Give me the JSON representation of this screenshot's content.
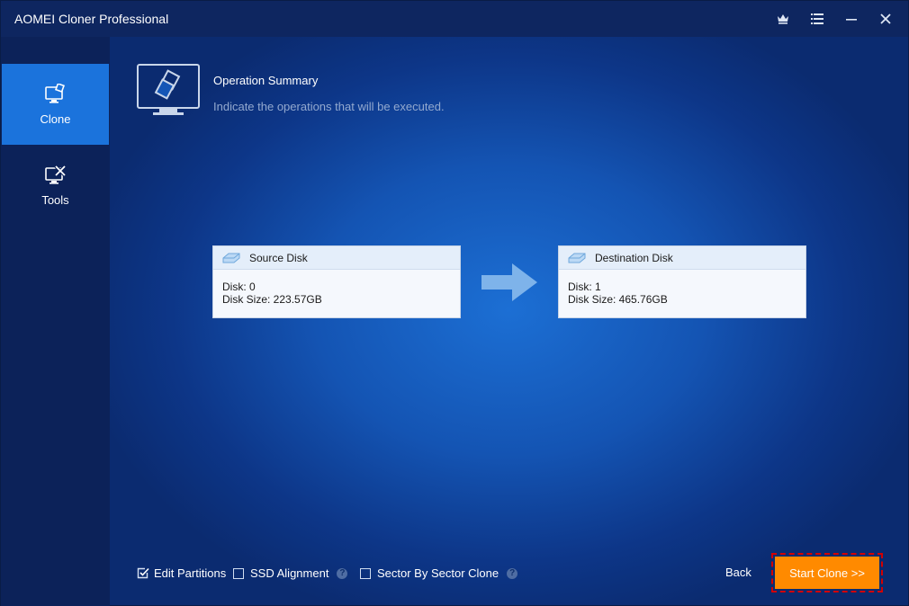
{
  "window": {
    "title": "AOMEI Cloner Professional"
  },
  "titlebar": {
    "icons": [
      "crown-icon",
      "menu-icon",
      "minimize-icon",
      "close-icon"
    ]
  },
  "sidebar": {
    "items": [
      {
        "label": "Clone",
        "icon": "clone-icon",
        "active": true
      },
      {
        "label": "Tools",
        "icon": "tools-icon",
        "active": false
      }
    ]
  },
  "summary": {
    "title": "Operation Summary",
    "subtitle": "Indicate the operations that will be executed."
  },
  "source": {
    "title": "Source Disk",
    "disk": "Disk: 0",
    "size": "Disk Size: 223.57GB"
  },
  "destination": {
    "title": "Destination Disk",
    "disk": "Disk: 1",
    "size": "Disk Size: 465.76GB"
  },
  "options": {
    "edit_partitions": {
      "label": "Edit Partitions",
      "checked": true
    },
    "ssd_alignment": {
      "label": "SSD Alignment",
      "checked": false
    },
    "sector_clone": {
      "label": "Sector By Sector Clone",
      "checked": false
    }
  },
  "buttons": {
    "back": "Back",
    "start": "Start Clone >>"
  },
  "colors": {
    "accent": "#1b73dc",
    "start_button": "#ff8a00",
    "highlight_outline": "#d20000"
  }
}
